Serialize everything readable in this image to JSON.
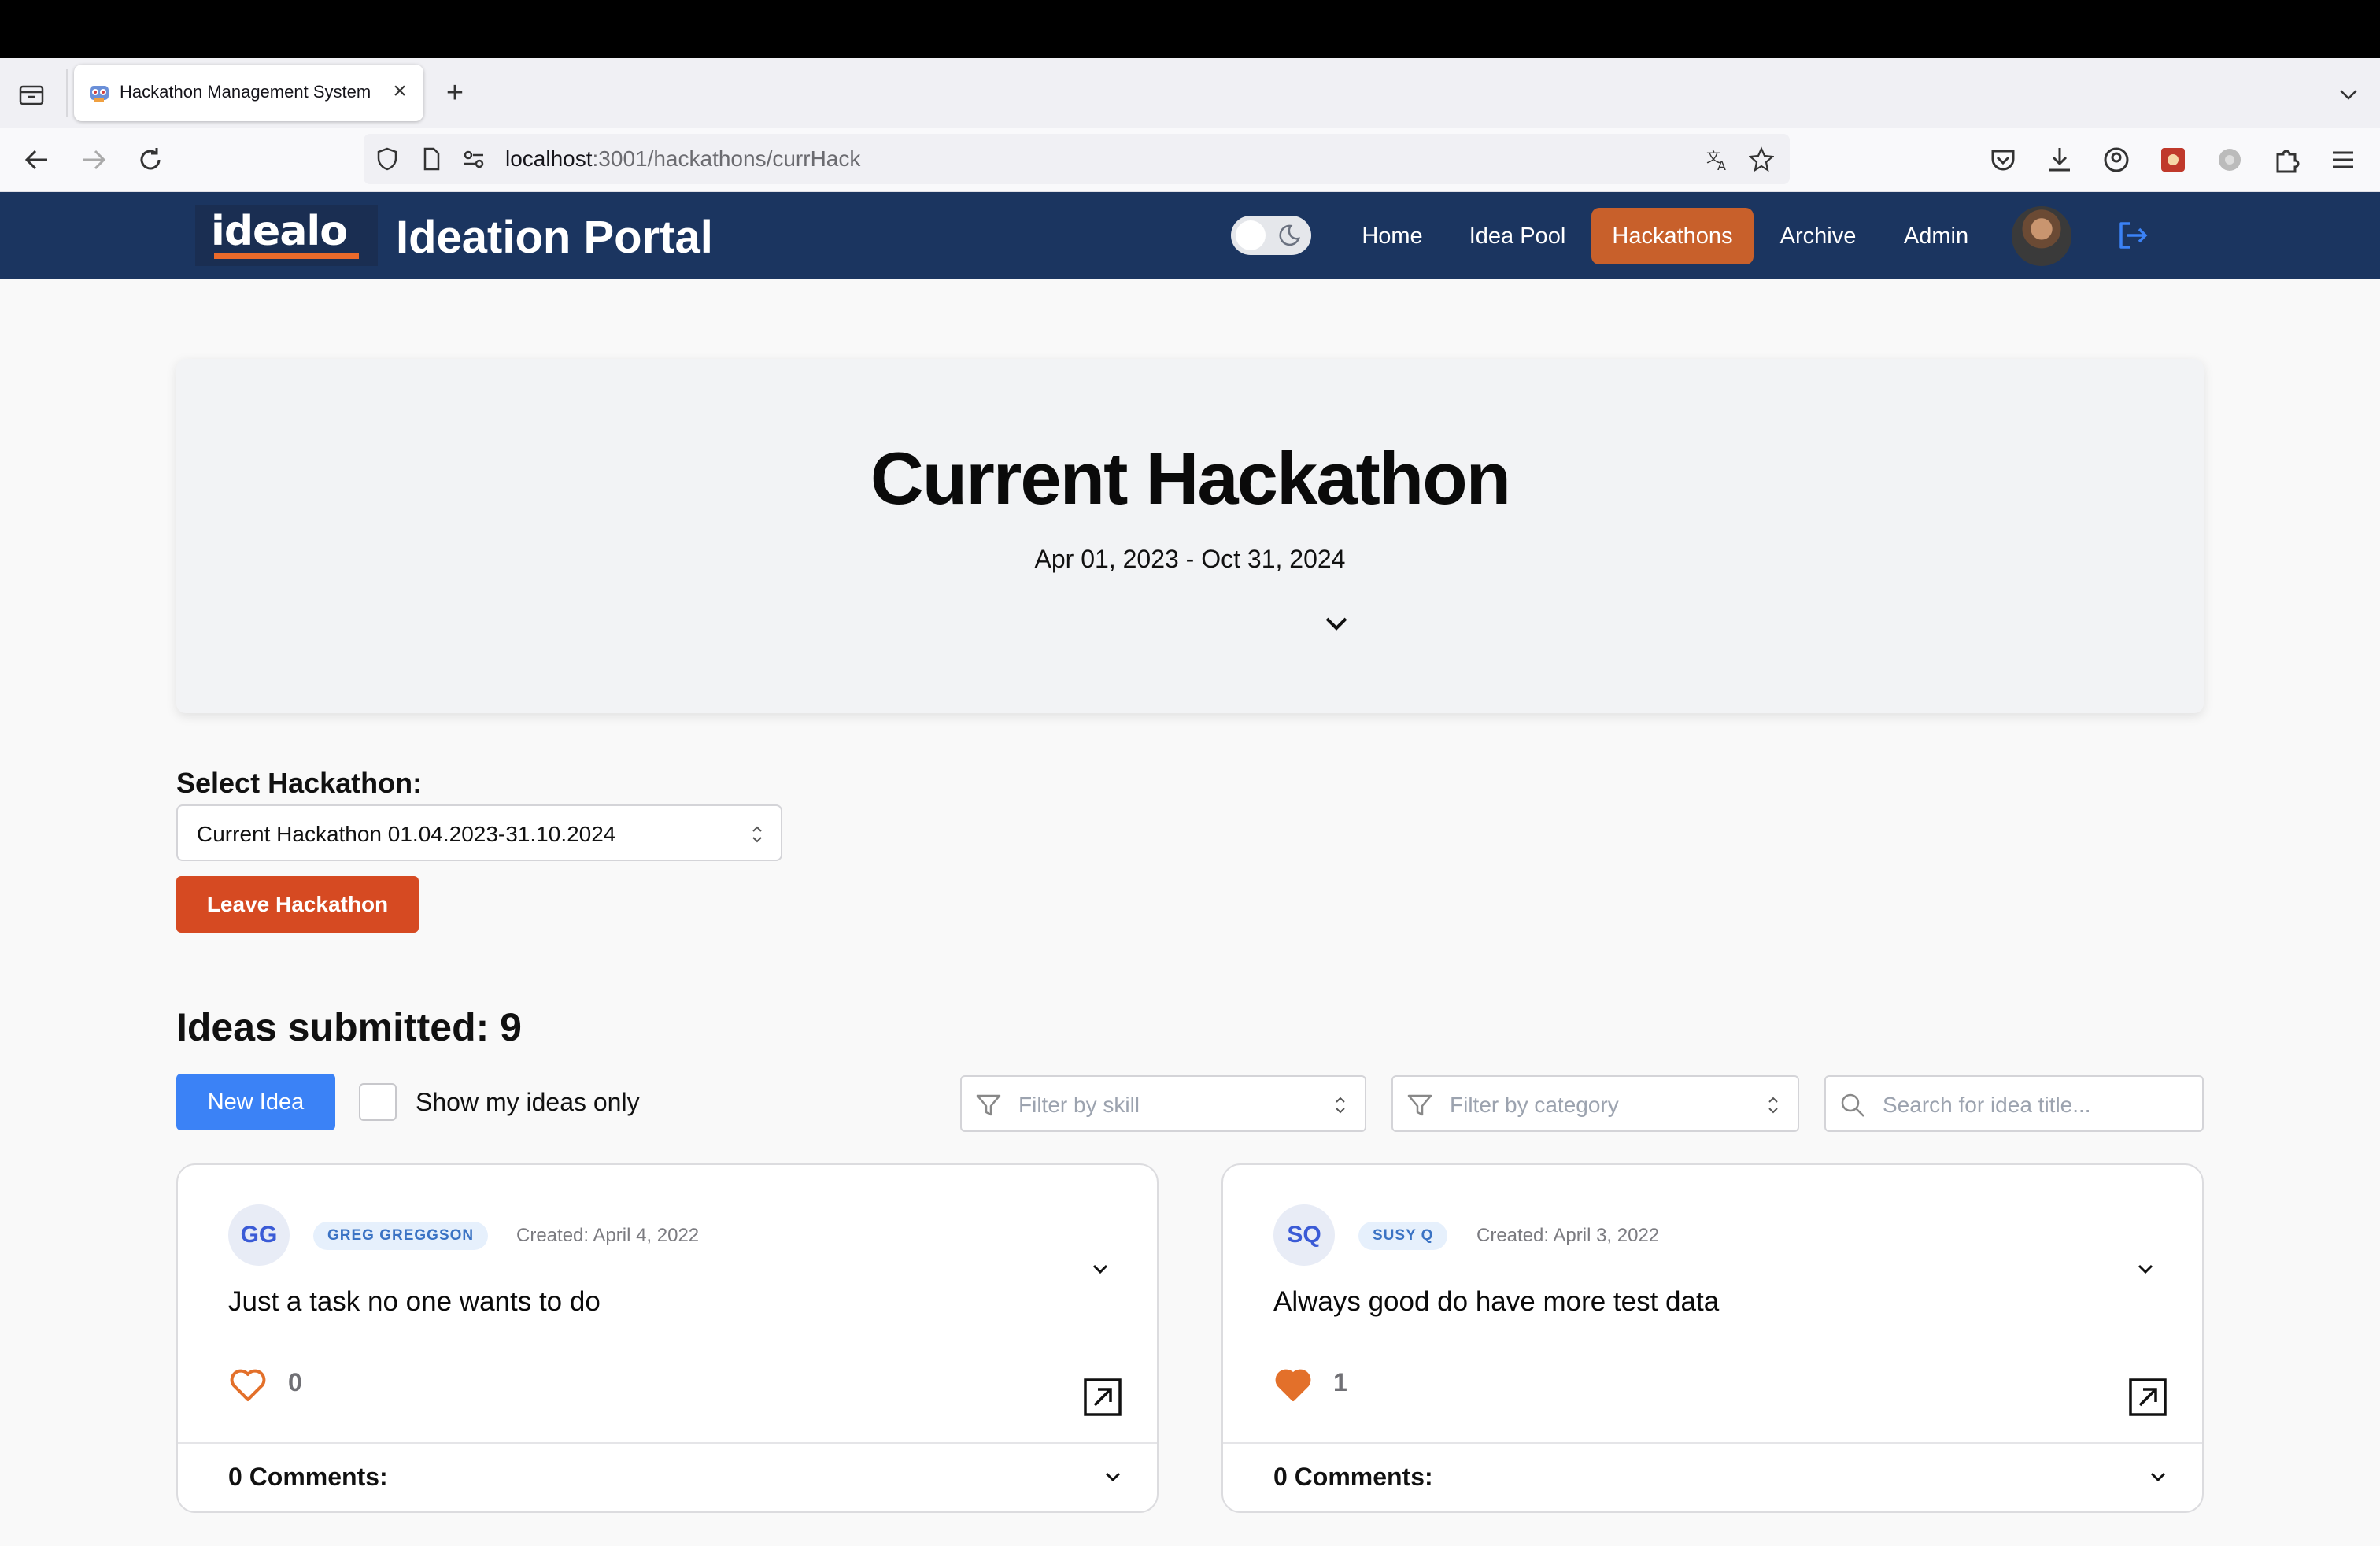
{
  "browser": {
    "tab_title": "Hackathon Management System",
    "url_host": "localhost",
    "url_rest": ":3001/hackathons/currHack"
  },
  "header": {
    "logo": "idealo",
    "title": "Ideation Portal",
    "nav": [
      {
        "label": "Home",
        "active": false
      },
      {
        "label": "Idea Pool",
        "active": false
      },
      {
        "label": "Hackathons",
        "active": true
      },
      {
        "label": "Archive",
        "active": false
      },
      {
        "label": "Admin",
        "active": false
      }
    ]
  },
  "hero": {
    "title": "Current Hackathon",
    "dates": "Apr 01, 2023 - Oct 31, 2024"
  },
  "select_hackathon": {
    "label": "Select Hackathon:",
    "value": "Current Hackathon 01.04.2023-31.10.2024",
    "leave_label": "Leave Hackathon"
  },
  "ideas": {
    "heading": "Ideas submitted: 9",
    "new_idea_label": "New Idea",
    "show_mine_label": "Show my ideas only",
    "show_mine_checked": false,
    "filter_skill_placeholder": "Filter by skill",
    "filter_category_placeholder": "Filter by category",
    "search_placeholder": "Search for idea title...",
    "cards": [
      {
        "initials": "GG",
        "author": "GREG GREGGSON",
        "created": "Created: April 4, 2022",
        "title": "Just a task no one wants to do",
        "likes": "0",
        "liked": false,
        "comments": "0 Comments:"
      },
      {
        "initials": "SQ",
        "author": "SUSY Q",
        "created": "Created: April 3, 2022",
        "title": "Always good do have more test data",
        "likes": "1",
        "liked": true,
        "comments": "0 Comments:"
      }
    ]
  },
  "colors": {
    "header_bg": "#1b3560",
    "active_nav": "#c8602b",
    "leave_button": "#d64a22",
    "new_idea_button": "#3b82f6",
    "heart": "#e3702a"
  }
}
